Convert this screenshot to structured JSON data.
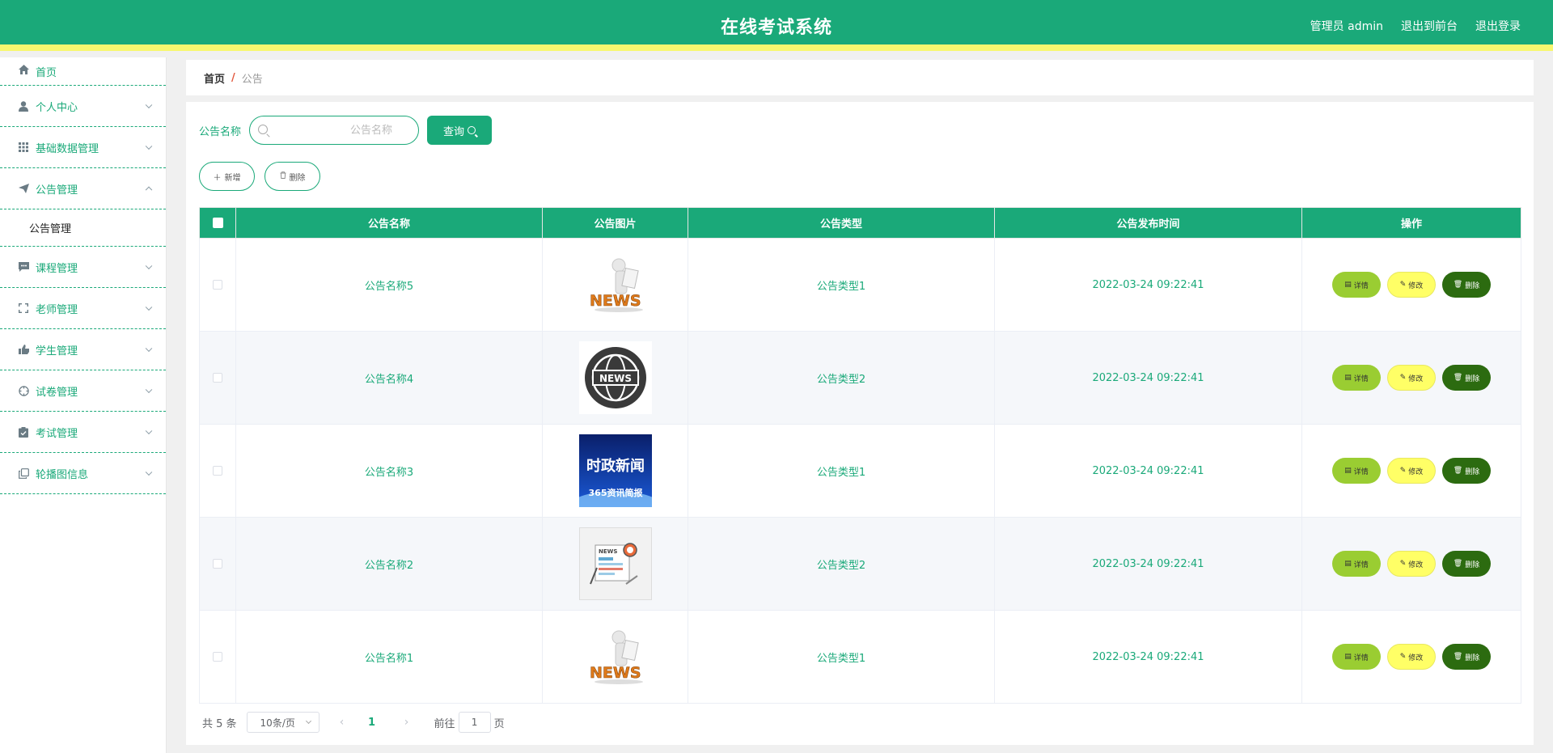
{
  "header": {
    "title": "在线考试系统",
    "links": [
      "管理员 admin",
      "退出到前台",
      "退出登录"
    ],
    "colors": {
      "brand": "#1aa979",
      "accent_stripe": "#f7f76f"
    }
  },
  "sidebar": {
    "items": [
      {
        "label": "首页",
        "icon": "home-icon",
        "expandable": false
      },
      {
        "label": "个人中心",
        "icon": "user-icon",
        "expandable": true
      },
      {
        "label": "基础数据管理",
        "icon": "grid-icon",
        "expandable": true
      },
      {
        "label": "公告管理",
        "icon": "paper-plane-icon",
        "expandable": true,
        "expanded": true,
        "children": [
          "公告管理"
        ]
      },
      {
        "label": "课程管理",
        "icon": "chat-icon",
        "expandable": true
      },
      {
        "label": "老师管理",
        "icon": "fullscreen-icon",
        "expandable": true
      },
      {
        "label": "学生管理",
        "icon": "thumb-icon",
        "expandable": true
      },
      {
        "label": "试卷管理",
        "icon": "compass-icon",
        "expandable": true
      },
      {
        "label": "考试管理",
        "icon": "clipboard-icon",
        "expandable": true
      },
      {
        "label": "轮播图信息",
        "icon": "copy-icon",
        "expandable": true
      }
    ]
  },
  "breadcrumb": {
    "home": "首页",
    "separator": "/",
    "current": "公告"
  },
  "search": {
    "label": "公告名称",
    "placeholder": "公告名称",
    "value": "",
    "button": "查询"
  },
  "actions": {
    "add": "新增",
    "delete": "删除"
  },
  "table": {
    "columns": [
      "公告名称",
      "公告图片",
      "公告类型",
      "公告发布时间",
      "操作"
    ],
    "rows": [
      {
        "name": "公告名称5",
        "image": "news-figure",
        "type": "公告类型1",
        "time": "2022-03-24 09:22:41"
      },
      {
        "name": "公告名称4",
        "image": "news-globe",
        "type": "公告类型2",
        "time": "2022-03-24 09:22:41"
      },
      {
        "name": "公告名称3",
        "image": "news-blue",
        "type": "公告类型1",
        "time": "2022-03-24 09:22:41"
      },
      {
        "name": "公告名称2",
        "image": "news-paper",
        "type": "公告类型2",
        "time": "2022-03-24 09:22:41"
      },
      {
        "name": "公告名称1",
        "image": "news-figure",
        "type": "公告类型1",
        "time": "2022-03-24 09:22:41"
      }
    ],
    "row_actions": {
      "detail": "详情",
      "edit": "修改",
      "delete": "删除"
    },
    "image_texts": {
      "news": "NEWS",
      "cn_title": "时政新闻",
      "cn_sub": "365资讯简报"
    }
  },
  "pagination": {
    "total": "共 5 条",
    "page_size": "10条/页",
    "current_page": "1",
    "goto_label": "前往",
    "goto_value": "1",
    "page_suffix": "页"
  }
}
